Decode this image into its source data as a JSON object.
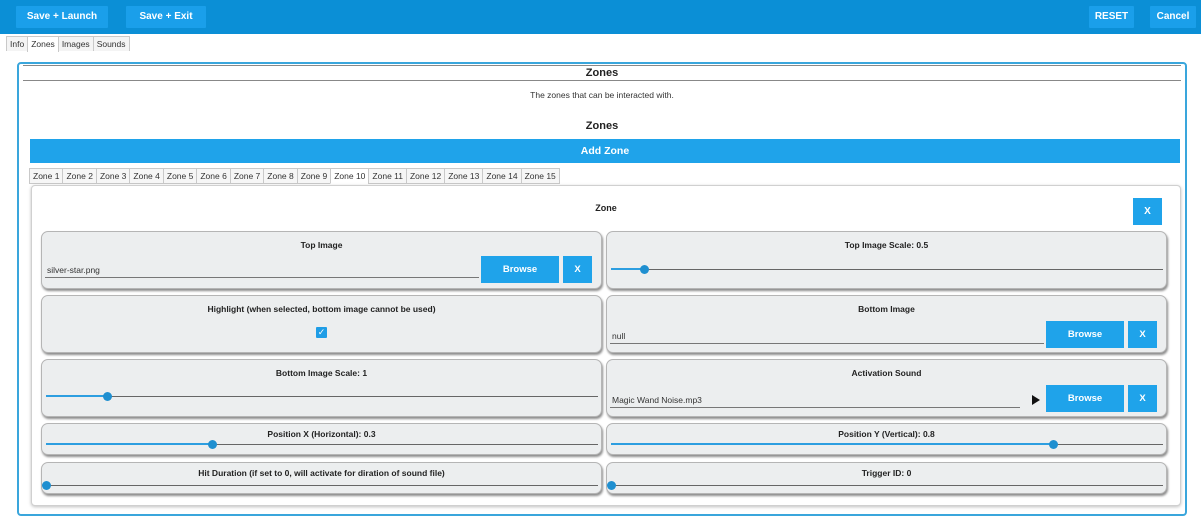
{
  "toolbar": {
    "save_launch": "Save + Launch",
    "save_exit": "Save + Exit",
    "reset": "RESET",
    "cancel": "Cancel"
  },
  "top_tabs": [
    "Info",
    "Zones",
    "Images",
    "Sounds"
  ],
  "section": {
    "title": "Zones",
    "description": "The zones that can be interacted with.",
    "subtitle": "Zones",
    "add_label": "Add Zone"
  },
  "zone_tabs": [
    "Zone 1",
    "Zone 2",
    "Zone 3",
    "Zone 4",
    "Zone 5",
    "Zone 6",
    "Zone 7",
    "Zone 8",
    "Zone 9",
    "Zone 10",
    "Zone 11",
    "Zone 12",
    "Zone 13",
    "Zone 14",
    "Zone 15"
  ],
  "active_zone_tab": "Zone 10",
  "zone": {
    "title": "Zone",
    "remove_label": "X",
    "top_image": {
      "title": "Top Image",
      "value": "silver-star.png",
      "browse": "Browse",
      "clear": "X"
    },
    "top_image_scale": {
      "title": "Top Image Scale: 0.5",
      "fraction": 0.06
    },
    "highlight": {
      "title": "Highlight (when selected, bottom image cannot be used)",
      "checked": true,
      "check_glyph": "✓"
    },
    "bottom_image": {
      "title": "Bottom Image",
      "value": "null",
      "browse": "Browse",
      "clear": "X"
    },
    "bottom_image_scale": {
      "title": "Bottom Image Scale: 1",
      "fraction": 0.11
    },
    "activation_sound": {
      "title": "Activation Sound",
      "value": "Magic Wand Noise.mp3",
      "browse": "Browse",
      "clear": "X"
    },
    "position_x": {
      "title": "Position X (Horizontal): 0.3",
      "fraction": 0.3
    },
    "position_y": {
      "title": "Position Y (Vertical): 0.8",
      "fraction": 0.8
    },
    "hit_duration": {
      "title": "Hit Duration (if set to 0, will activate for diration of sound file)",
      "fraction": 0.0
    },
    "trigger_id": {
      "title": "Trigger ID: 0",
      "fraction": 0.0
    }
  }
}
